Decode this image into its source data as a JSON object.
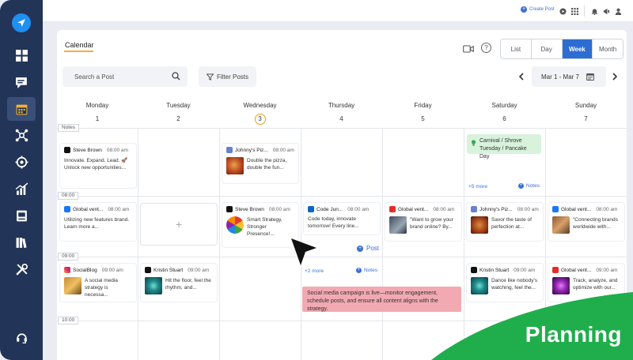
{
  "topbar": {
    "create_post": "Create Post"
  },
  "calendar": {
    "title": "Calendar",
    "search_placeholder": "Search a Post",
    "filter_label": "Filter Posts",
    "help_label": "?",
    "view_tabs": [
      "List",
      "Day",
      "Week",
      "Month"
    ],
    "active_view": "Week",
    "date_range": "Mar 1 - Mar 7",
    "days": [
      {
        "name": "Monday",
        "num": "1"
      },
      {
        "name": "Tuesday",
        "num": "2"
      },
      {
        "name": "Wednesday",
        "num": "3"
      },
      {
        "name": "Thursday",
        "num": "4"
      },
      {
        "name": "Friday",
        "num": "5"
      },
      {
        "name": "Saturday",
        "num": "6"
      },
      {
        "name": "Sunday",
        "num": "7"
      }
    ],
    "time_labels": [
      "Notes",
      "08:00",
      "09:00",
      "10:00"
    ],
    "holiday": "Carnival / Shrove Tuesday / Pancake Day",
    "sat_more": "+5 more",
    "sat_notes": "Notes",
    "thu_more": "+2 more",
    "thu_notes": "Notes",
    "thu_post": "Post",
    "note_banner": "Social media campaign is live—monitor engagement, schedule posts, and ensure all content aligns with the strategy.",
    "posts": {
      "mon_notes": {
        "account": "Steve Brown",
        "time": "08:00 am",
        "text": "Innovate. Expand. Lead. 🚀 Unlock new opportunities..."
      },
      "wed_notes": {
        "account": "Johnny's Piz...",
        "time": "08:00 am",
        "text": "Double the pizza, double the fun..."
      },
      "mon_8": {
        "account": "Global vent...",
        "time": "08:00 am",
        "text": "Utilizing new features brand. Learn more a..."
      },
      "wed_8": {
        "account": "Steve Brown",
        "time": "08:00 am",
        "text": "Smart Strategy, Stronger Presence!..."
      },
      "thu_8": {
        "account": "Code Jun...",
        "time": "08:00 am",
        "text": "Code today, innovate tomorrow! Every line..."
      },
      "fri_8": {
        "account": "Global vent...",
        "time": "08:00 am",
        "text": "\"Want to grow your brand online? By..."
      },
      "sat_8": {
        "account": "Johnny's Piz...",
        "time": "08:00 am",
        "text": "Savor the taste of perfection at..."
      },
      "sun_8": {
        "account": "Global vent...",
        "time": "08:00 am",
        "text": "\"Connecting brands worldwide with..."
      },
      "mon_9": {
        "account": "SocialBlog",
        "time": "09:00 am",
        "text": "A social media strategy is necessa..."
      },
      "tue_9": {
        "account": "Kristin Stuart",
        "time": "09:00 am",
        "text": "Hit the floor, feel the rhythm, and..."
      },
      "sat_9": {
        "account": "Kristin Stuart",
        "time": "09:00 am",
        "text": "Dance like nobody's watching, feel the..."
      },
      "sun_9": {
        "account": "Global vent...",
        "time": "09:00 am",
        "text": "Track, analyze, and optimize with our..."
      }
    }
  },
  "badge": {
    "label": "Planning"
  },
  "colors": {
    "sidebar": "#223457",
    "accent": "#2d6cd3",
    "holiday": "#d8f2dc",
    "note": "#f2a9b2",
    "badge": "#1fae4b"
  }
}
